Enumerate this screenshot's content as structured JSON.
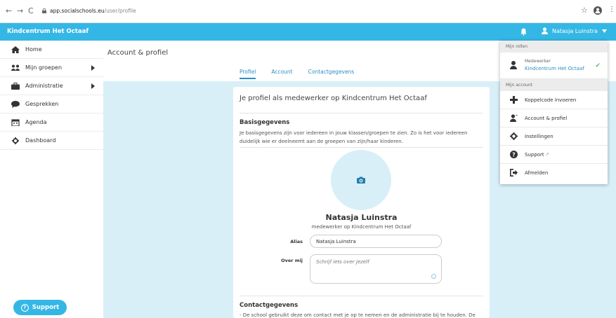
{
  "browser": {
    "url_host": "app.socialschools.eu",
    "url_path": "/user/profile"
  },
  "app": {
    "brand": "Kindcentrum Het Octaaf",
    "user_name": "Natasja Luinstra"
  },
  "sidebar": {
    "items": [
      {
        "label": "Home"
      },
      {
        "label": "Mijn groepen"
      },
      {
        "label": "Administratie"
      },
      {
        "label": "Gesprekken"
      },
      {
        "label": "Agenda"
      },
      {
        "label": "Dashboard"
      }
    ],
    "support_label": "Support"
  },
  "main": {
    "page_title": "Account & profiel",
    "tabs": [
      {
        "label": "Profiel"
      },
      {
        "label": "Account"
      },
      {
        "label": "Contactgegevens"
      }
    ]
  },
  "profile": {
    "card_title": "Je profiel als medewerker op Kindcentrum Het Octaaf",
    "basis_title": "Basisgegevens",
    "basis_text": "Je basisgegevens zijn voor iedereen in jouw klassen/groepen te zien. Zo is het voor iedereen duidelijk wie er deelneemt aan de groepen van zijn/haar kinderen.",
    "full_name": "Natasja Luinstra",
    "role": "medewerker op Kindcentrum Het Octaaf",
    "alias_label": "Alias",
    "alias_value": "Natasja Luinstra",
    "about_label": "Over mij",
    "about_placeholder": "Schrijf iets over jezelf",
    "contact_title": "Contactgegevens",
    "contact_text": "- De school gebruikt deze om contact met je op te nemen en de administratie bij te houden. De"
  },
  "dropdown": {
    "roles_header": "Mijn rollen",
    "role_title": "Medewerker",
    "role_org": "Kindcentrum Het Octaaf",
    "account_header": "Mijn account",
    "items": [
      {
        "label": "Koppelcode invoeren"
      },
      {
        "label": "Account & profiel"
      },
      {
        "label": "Instellingen"
      },
      {
        "label": "Support"
      },
      {
        "label": "Afmelden"
      }
    ]
  },
  "colors": {
    "brand": "#35b7e6",
    "link": "#2b8fc4",
    "page_bg": "#d8eff8"
  }
}
